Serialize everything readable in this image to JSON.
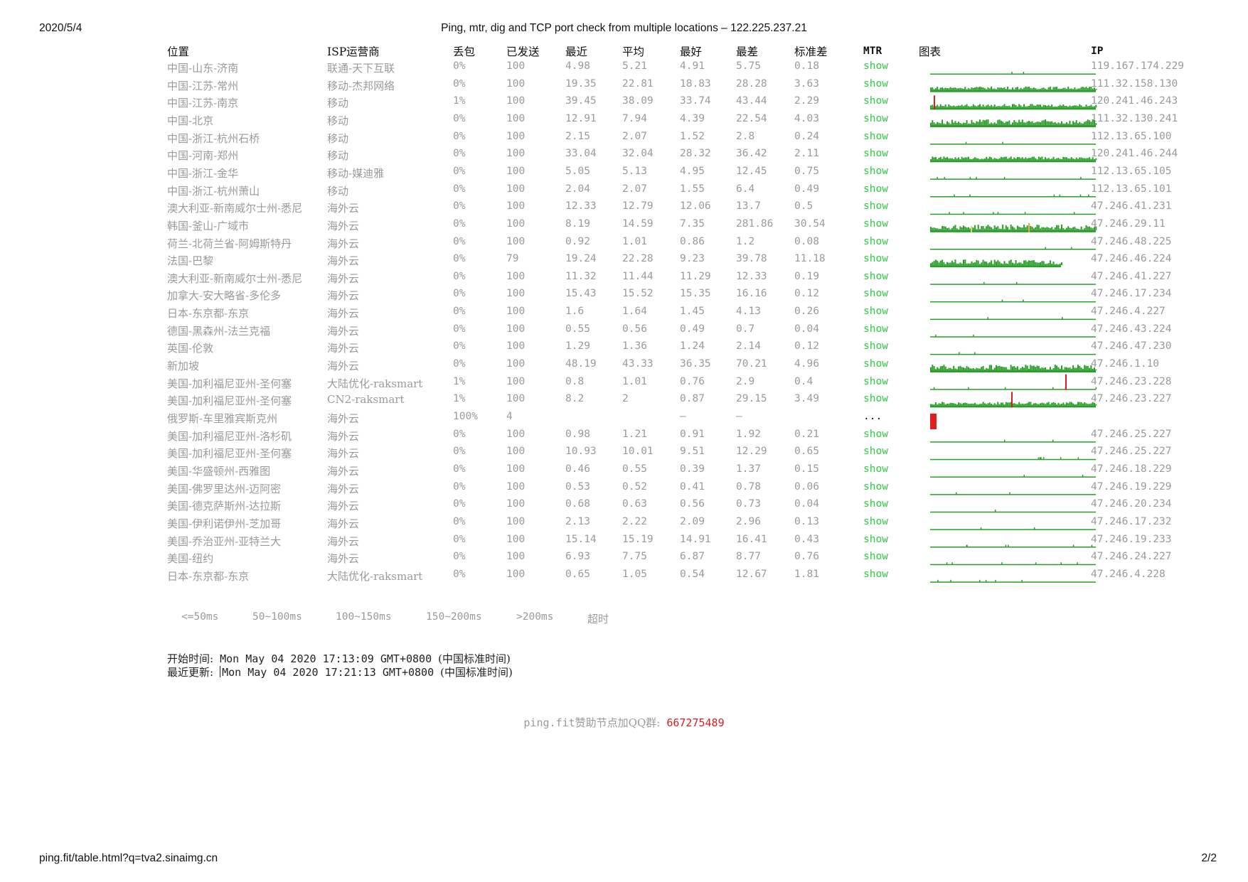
{
  "print_header": {
    "date": "2020/5/4",
    "title": "Ping, mtr, dig and TCP port check from multiple locations – 122.225.237.21"
  },
  "print_footer": {
    "url": "ping.fit/table.html?q=tva2.sinaimg.cn",
    "page": "2/2"
  },
  "table": {
    "headers": {
      "location": "位置",
      "isp": "ISP运营商",
      "loss": "丢包",
      "sent": "已发送",
      "last": "最近",
      "avg": "平均",
      "best": "最好",
      "worst": "最差",
      "stdev": "标准差",
      "mtr": "MTR",
      "chart": "图表",
      "ip": "IP"
    },
    "rows": [
      {
        "location": "中国-山东-济南",
        "isp": "联通-天下互联",
        "loss": "0%",
        "sent": "100",
        "last": "4.98",
        "avg": "5.21",
        "best": "4.91",
        "worst": "5.75",
        "stdev": "0.18",
        "mtr": "show",
        "ip": "119.167.174.229"
      },
      {
        "location": "中国-江苏-常州",
        "isp": "移动-杰邦网络",
        "loss": "0%",
        "sent": "100",
        "last": "19.35",
        "avg": "22.81",
        "best": "18.83",
        "worst": "28.28",
        "stdev": "3.63",
        "mtr": "show",
        "ip": "111.32.158.130"
      },
      {
        "location": "中国-江苏-南京",
        "isp": "移动",
        "loss": "1%",
        "sent": "100",
        "last": "39.45",
        "avg": "38.09",
        "best": "33.74",
        "worst": "43.44",
        "stdev": "2.29",
        "mtr": "show",
        "ip": "120.241.46.243"
      },
      {
        "location": "中国-北京",
        "isp": "移动",
        "loss": "0%",
        "sent": "100",
        "last": "12.91",
        "avg": "7.94",
        "best": "4.39",
        "worst": "22.54",
        "stdev": "4.03",
        "mtr": "show",
        "ip": "111.32.130.241"
      },
      {
        "location": "中国-浙江-杭州石桥",
        "isp": "移动",
        "loss": "0%",
        "sent": "100",
        "last": "2.15",
        "avg": "2.07",
        "best": "1.52",
        "worst": "2.8",
        "stdev": "0.24",
        "mtr": "show",
        "ip": "112.13.65.100"
      },
      {
        "location": "中国-河南-郑州",
        "isp": "移动",
        "loss": "0%",
        "sent": "100",
        "last": "33.04",
        "avg": "32.04",
        "best": "28.32",
        "worst": "36.42",
        "stdev": "2.11",
        "mtr": "show",
        "ip": "120.241.46.244"
      },
      {
        "location": "中国-浙江-金华",
        "isp": "移动-媒迪雅",
        "loss": "0%",
        "sent": "100",
        "last": "5.05",
        "avg": "5.13",
        "best": "4.95",
        "worst": "12.45",
        "stdev": "0.75",
        "mtr": "show",
        "ip": "112.13.65.105"
      },
      {
        "location": "中国-浙江-杭州萧山",
        "isp": "移动",
        "loss": "0%",
        "sent": "100",
        "last": "2.04",
        "avg": "2.07",
        "best": "1.55",
        "worst": "6.4",
        "stdev": "0.49",
        "mtr": "show",
        "ip": "112.13.65.101"
      },
      {
        "location": "澳大利亚-新南威尔士州-悉尼",
        "isp": "海外云",
        "loss": "0%",
        "sent": "100",
        "last": "12.33",
        "avg": "12.79",
        "best": "12.06",
        "worst": "13.7",
        "stdev": "0.5",
        "mtr": "show",
        "ip": "47.246.41.231"
      },
      {
        "location": "韩国-釜山-广域市",
        "isp": "海外云",
        "loss": "0%",
        "sent": "100",
        "last": "8.19",
        "avg": "14.59",
        "best": "7.35",
        "worst": "281.86",
        "stdev": "30.54",
        "mtr": "show",
        "ip": "47.246.29.11"
      },
      {
        "location": "荷兰-北荷兰省-阿姆斯特丹",
        "isp": "海外云",
        "loss": "0%",
        "sent": "100",
        "last": "0.92",
        "avg": "1.01",
        "best": "0.86",
        "worst": "1.2",
        "stdev": "0.08",
        "mtr": "show",
        "ip": "47.246.48.225"
      },
      {
        "location": "法国-巴黎",
        "isp": "海外云",
        "loss": "0%",
        "sent": "79",
        "last": "19.24",
        "avg": "22.28",
        "best": "9.23",
        "worst": "39.78",
        "stdev": "11.18",
        "mtr": "show",
        "ip": "47.246.46.224"
      },
      {
        "location": "澳大利亚-新南威尔士州-悉尼",
        "isp": "海外云",
        "loss": "0%",
        "sent": "100",
        "last": "11.32",
        "avg": "11.44",
        "best": "11.29",
        "worst": "12.33",
        "stdev": "0.19",
        "mtr": "show",
        "ip": "47.246.41.227"
      },
      {
        "location": "加拿大-安大略省-多伦多",
        "isp": "海外云",
        "loss": "0%",
        "sent": "100",
        "last": "15.43",
        "avg": "15.52",
        "best": "15.35",
        "worst": "16.16",
        "stdev": "0.12",
        "mtr": "show",
        "ip": "47.246.17.234"
      },
      {
        "location": "日本-东京都-东京",
        "isp": "海外云",
        "loss": "0%",
        "sent": "100",
        "last": "1.6",
        "avg": "1.64",
        "best": "1.45",
        "worst": "4.13",
        "stdev": "0.26",
        "mtr": "show",
        "ip": "47.246.4.227"
      },
      {
        "location": "德国-黑森州-法兰克福",
        "isp": "海外云",
        "loss": "0%",
        "sent": "100",
        "last": "0.55",
        "avg": "0.56",
        "best": "0.49",
        "worst": "0.7",
        "stdev": "0.04",
        "mtr": "show",
        "ip": "47.246.43.224"
      },
      {
        "location": "英国-伦敦",
        "isp": "海外云",
        "loss": "0%",
        "sent": "100",
        "last": "1.29",
        "avg": "1.36",
        "best": "1.24",
        "worst": "2.14",
        "stdev": "0.12",
        "mtr": "show",
        "ip": "47.246.47.230"
      },
      {
        "location": "新加坡",
        "isp": "海外云",
        "loss": "0%",
        "sent": "100",
        "last": "48.19",
        "avg": "43.33",
        "best": "36.35",
        "worst": "70.21",
        "stdev": "4.96",
        "mtr": "show",
        "ip": "47.246.1.10"
      },
      {
        "location": "美国-加利福尼亚州-圣何塞",
        "isp": "大陆优化-raksmart",
        "loss": "1%",
        "sent": "100",
        "last": "0.8",
        "avg": "1.01",
        "best": "0.76",
        "worst": "2.9",
        "stdev": "0.4",
        "mtr": "show",
        "ip": "47.246.23.228"
      },
      {
        "location": "美国-加利福尼亚州-圣何塞",
        "isp": "CN2-raksmart",
        "loss": "1%",
        "sent": "100",
        "last": "8.2",
        "avg": "2",
        "best": "0.87",
        "worst": "29.15",
        "stdev": "3.49",
        "mtr": "show",
        "ip": "47.246.23.227"
      },
      {
        "location": "俄罗斯-车里雅宾斯克州",
        "isp": "海外云",
        "loss": "100%",
        "sent": "4",
        "last": "",
        "avg": "",
        "best": "–",
        "worst": "–",
        "stdev": "",
        "mtr": "...",
        "ip": ""
      },
      {
        "location": "美国-加利福尼亚州-洛杉矶",
        "isp": "海外云",
        "loss": "0%",
        "sent": "100",
        "last": "0.98",
        "avg": "1.21",
        "best": "0.91",
        "worst": "1.92",
        "stdev": "0.21",
        "mtr": "show",
        "ip": "47.246.25.227"
      },
      {
        "location": "美国-加利福尼亚州-圣何塞",
        "isp": "海外云",
        "loss": "0%",
        "sent": "100",
        "last": "10.93",
        "avg": "10.01",
        "best": "9.51",
        "worst": "12.29",
        "stdev": "0.65",
        "mtr": "show",
        "ip": "47.246.25.227"
      },
      {
        "location": "美国-华盛顿州-西雅图",
        "isp": "海外云",
        "loss": "0%",
        "sent": "100",
        "last": "0.46",
        "avg": "0.55",
        "best": "0.39",
        "worst": "1.37",
        "stdev": "0.15",
        "mtr": "show",
        "ip": "47.246.18.229"
      },
      {
        "location": "美国-佛罗里达州-迈阿密",
        "isp": "海外云",
        "loss": "0%",
        "sent": "100",
        "last": "0.53",
        "avg": "0.52",
        "best": "0.41",
        "worst": "0.78",
        "stdev": "0.06",
        "mtr": "show",
        "ip": "47.246.19.229"
      },
      {
        "location": "美国-德克萨斯州-达拉斯",
        "isp": "海外云",
        "loss": "0%",
        "sent": "100",
        "last": "0.68",
        "avg": "0.63",
        "best": "0.56",
        "worst": "0.73",
        "stdev": "0.04",
        "mtr": "show",
        "ip": "47.246.20.234"
      },
      {
        "location": "美国-伊利诺伊州-芝加哥",
        "isp": "海外云",
        "loss": "0%",
        "sent": "100",
        "last": "2.13",
        "avg": "2.22",
        "best": "2.09",
        "worst": "2.96",
        "stdev": "0.13",
        "mtr": "show",
        "ip": "47.246.17.232"
      },
      {
        "location": "美国-乔治亚州-亚特兰大",
        "isp": "海外云",
        "loss": "0%",
        "sent": "100",
        "last": "15.14",
        "avg": "15.19",
        "best": "14.91",
        "worst": "16.41",
        "stdev": "0.43",
        "mtr": "show",
        "ip": "47.246.19.233"
      },
      {
        "location": "美国-纽约",
        "isp": "海外云",
        "loss": "0%",
        "sent": "100",
        "last": "6.93",
        "avg": "7.75",
        "best": "6.87",
        "worst": "8.77",
        "stdev": "0.76",
        "mtr": "show",
        "ip": "47.246.24.227"
      },
      {
        "location": "日本-东京都-东京",
        "isp": "大陆优化-raksmart",
        "loss": "0%",
        "sent": "100",
        "last": "0.65",
        "avg": "1.05",
        "best": "0.54",
        "worst": "12.67",
        "stdev": "1.81",
        "mtr": "show",
        "ip": "47.246.4.228"
      }
    ]
  },
  "legend": {
    "items": [
      "<=50ms",
      "50~100ms",
      "100~150ms",
      "150~200ms",
      ">200ms",
      "超时"
    ]
  },
  "times": {
    "start_label": "开始时间:",
    "start_value": "Mon May 04 2020 17:13:09 GMT+0800",
    "start_tz": "(中国标准时间)",
    "update_label": "最近更新:",
    "update_value": "Mon May 04 2020 17:21:13 GMT+0800",
    "update_tz": "(中国标准时间)"
  },
  "sponsor": {
    "prefix": "ping.fit",
    "text": "赞助节点加QQ群:",
    "qq": "667275489"
  },
  "colors": {
    "mtr_link": "#2ecc40",
    "latency_ok": "#2a9d2a",
    "latency_spike_yellow": "#c7e35a",
    "latency_spike_orange": "#e8a33a",
    "latency_spike_red": "#d62020",
    "timeout": "#e02020",
    "qq_number": "#d62020"
  }
}
